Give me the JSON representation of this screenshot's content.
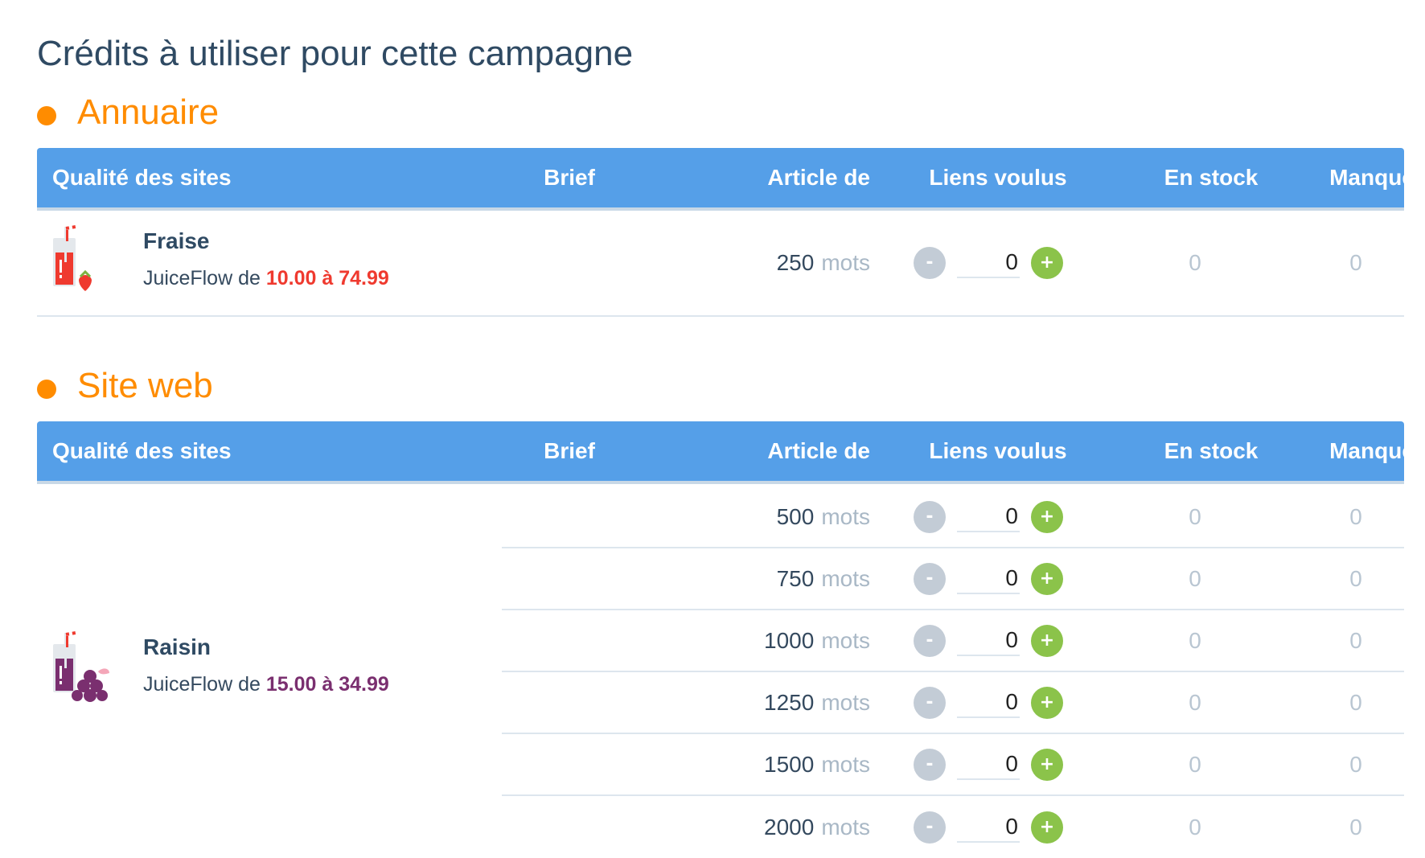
{
  "page_title": "Crédits à utiliser pour cette campagne",
  "columns": [
    "Qualité des sites",
    "Brief",
    "Article de",
    "Liens voulus",
    "En stock",
    "Manque"
  ],
  "sections": [
    {
      "title": "Annuaire",
      "qualities": [
        {
          "name": "Fraise",
          "icon": "strawberry-juice-icon",
          "range_prefix": "JuiceFlow de",
          "range": "10.00 à 74.99",
          "range_color": "#ef3a2f",
          "rows": [
            {
              "words": "250",
              "unit": "mots",
              "quantity": "0",
              "in_stock": "0",
              "missing": "0"
            }
          ]
        }
      ]
    },
    {
      "title": "Site web",
      "qualities": [
        {
          "name": "Raisin",
          "icon": "grape-juice-icon",
          "range_prefix": "JuiceFlow de",
          "range": "15.00 à 34.99",
          "range_color": "#7a2f6f",
          "rows": [
            {
              "words": "500",
              "unit": "mots",
              "quantity": "0",
              "in_stock": "0",
              "missing": "0"
            },
            {
              "words": "750",
              "unit": "mots",
              "quantity": "0",
              "in_stock": "0",
              "missing": "0"
            },
            {
              "words": "1000",
              "unit": "mots",
              "quantity": "0",
              "in_stock": "0",
              "missing": "0"
            },
            {
              "words": "1250",
              "unit": "mots",
              "quantity": "0",
              "in_stock": "0",
              "missing": "0"
            },
            {
              "words": "1500",
              "unit": "mots",
              "quantity": "0",
              "in_stock": "0",
              "missing": "0"
            },
            {
              "words": "2000",
              "unit": "mots",
              "quantity": "0",
              "in_stock": "0",
              "missing": "0"
            }
          ]
        }
      ]
    }
  ],
  "buttons": {
    "minus": "-",
    "plus": "+"
  },
  "colors": {
    "accent_orange": "#ff8c00",
    "header_blue": "#559fe8",
    "plus_green": "#8bc34a",
    "minus_grey": "#c3ccd6"
  }
}
